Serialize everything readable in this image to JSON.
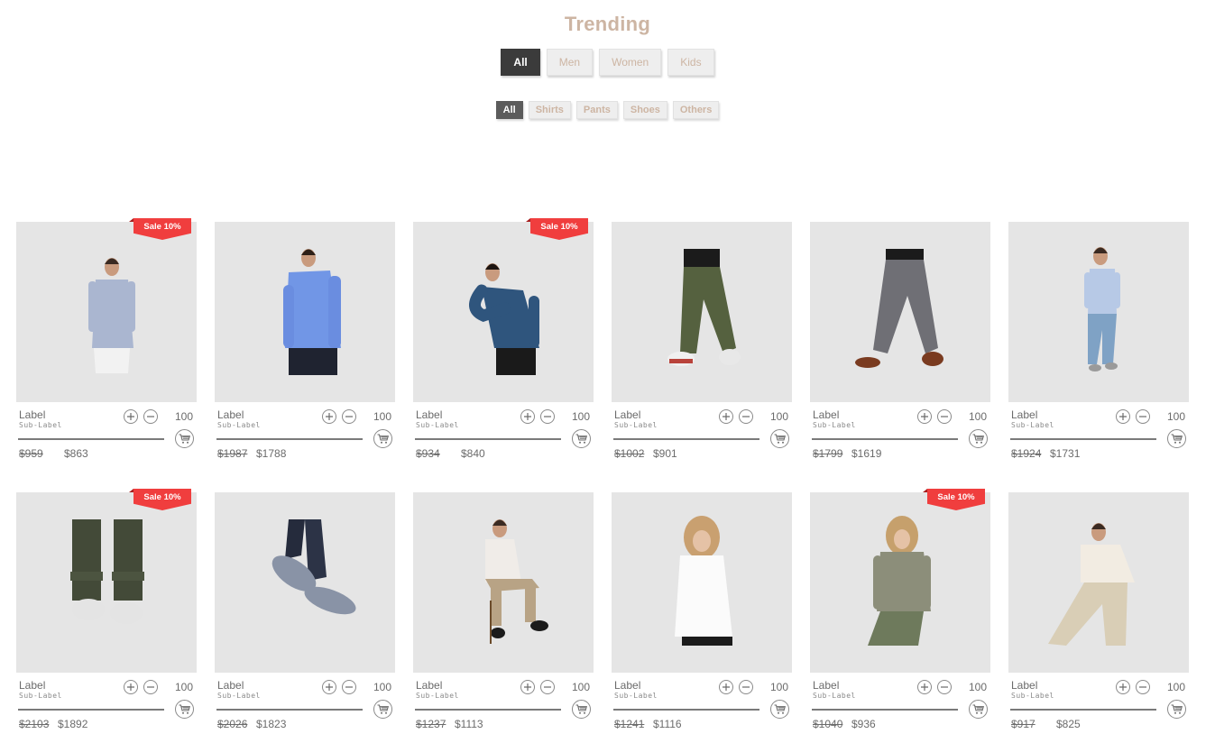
{
  "page": {
    "title": "Trending"
  },
  "category_tabs": [
    {
      "label": "All",
      "active": true
    },
    {
      "label": "Men",
      "active": false
    },
    {
      "label": "Women",
      "active": false
    },
    {
      "label": "Kids",
      "active": false
    }
  ],
  "subcategory_tabs": [
    {
      "label": "All",
      "active": true
    },
    {
      "label": "Shirts",
      "active": false
    },
    {
      "label": "Pants",
      "active": false
    },
    {
      "label": "Shoes",
      "active": false
    },
    {
      "label": "Others",
      "active": false
    }
  ],
  "colors": {
    "accent": "#cdb5a3",
    "sale_badge": "#f03e3e",
    "active_tab": "#3b3b3b",
    "card_bg": "#e5e5e5"
  },
  "icons": {
    "plus": "plus-circle-icon",
    "minus": "minus-circle-icon",
    "cart": "shopping-cart-icon"
  },
  "products": [
    {
      "label": "Label",
      "sublabel": "Sub-Label",
      "qty": "100",
      "old_price": "$959",
      "price": "$863",
      "sale": "Sale 10%",
      "image": "man in light blue kurta shirt"
    },
    {
      "label": "Label",
      "sublabel": "Sub-Label",
      "qty": "100",
      "old_price": "$1987",
      "price": "$1788",
      "sale": "",
      "image": "man in blue button shirt"
    },
    {
      "label": "Label",
      "sublabel": "Sub-Label",
      "qty": "100",
      "old_price": "$934",
      "price": "$840",
      "sale": "Sale 10%",
      "image": "man in navy sweater"
    },
    {
      "label": "Label",
      "sublabel": "Sub-Label",
      "qty": "100",
      "old_price": "$1002",
      "price": "$901",
      "sale": "",
      "image": "olive cargo pants with sneakers"
    },
    {
      "label": "Label",
      "sublabel": "Sub-Label",
      "qty": "100",
      "old_price": "$1799",
      "price": "$1619",
      "sale": "",
      "image": "grey trousers with brown shoes"
    },
    {
      "label": "Label",
      "sublabel": "Sub-Label",
      "qty": "100",
      "old_price": "$1924",
      "price": "$1731",
      "sale": "",
      "image": "man in striped shirt and ripped jeans"
    },
    {
      "label": "Label",
      "sublabel": "Sub-Label",
      "qty": "100",
      "old_price": "$2103",
      "price": "$1892",
      "sale": "Sale 10%",
      "image": "white sneakers with olive pants"
    },
    {
      "label": "Label",
      "sublabel": "Sub-Label",
      "qty": "100",
      "old_price": "$2026",
      "price": "$1823",
      "sale": "",
      "image": "grey knit sneakers"
    },
    {
      "label": "Label",
      "sublabel": "Sub-Label",
      "qty": "100",
      "old_price": "$1237",
      "price": "$1113",
      "sale": "",
      "image": "seated man in white shirt and khakis"
    },
    {
      "label": "Label",
      "sublabel": "Sub-Label",
      "qty": "100",
      "old_price": "$1241",
      "price": "$1116",
      "sale": "",
      "image": "woman in white blouse"
    },
    {
      "label": "Label",
      "sublabel": "Sub-Label",
      "qty": "100",
      "old_price": "$1040",
      "price": "$936",
      "sale": "Sale 10%",
      "image": "woman in floral blouse and green pants"
    },
    {
      "label": "Label",
      "sublabel": "Sub-Label",
      "qty": "100",
      "old_price": "$917",
      "price": "$825",
      "sale": "",
      "image": "woman in cream blouse and wide pants"
    }
  ]
}
